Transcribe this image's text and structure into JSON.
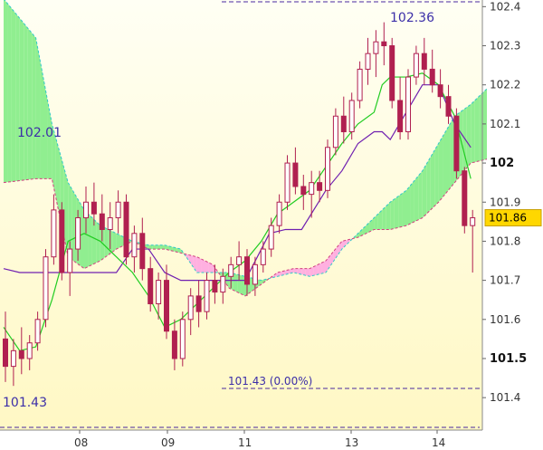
{
  "chart_data": {
    "type": "candlestick",
    "x_labels": [
      "08",
      "09",
      "11",
      "13",
      "14"
    ],
    "y_ticks": [
      {
        "v": 102.4,
        "label": "102.4",
        "bold": false
      },
      {
        "v": 102.3,
        "label": "102.3",
        "bold": false
      },
      {
        "v": 102.2,
        "label": "102.2",
        "bold": false
      },
      {
        "v": 102.1,
        "label": "102.1",
        "bold": false
      },
      {
        "v": 102.0,
        "label": "102",
        "bold": true
      },
      {
        "v": 101.9,
        "label": "101.9",
        "bold": false
      },
      {
        "v": 101.8,
        "label": "101.8",
        "bold": false
      },
      {
        "v": 101.7,
        "label": "101.7",
        "bold": false
      },
      {
        "v": 101.6,
        "label": "101.6",
        "bold": false
      },
      {
        "v": 101.5,
        "label": "101.5",
        "bold": true
      },
      {
        "v": 101.4,
        "label": "101.4",
        "bold": false
      }
    ],
    "ylim": [
      101.317,
      102.417
    ],
    "current_price": "101.86",
    "current_value": 101.86,
    "annotations": {
      "high_label": "102.36",
      "left_label": "102.01",
      "low_label": "101.43",
      "low_line_label": "101.43 (0.00%)"
    },
    "colors": {
      "bull": "#b02050",
      "bear": "#b02050",
      "tenkan": "#7020b0",
      "kijun": "#22cc22",
      "cloud_bull": "#90ee90",
      "cloud_bear": "#ffb0e0",
      "price_tag": "#ffd700"
    },
    "candles": [
      [
        101.55,
        101.62,
        101.44,
        101.48
      ],
      [
        101.48,
        101.55,
        101.43,
        101.52
      ],
      [
        101.52,
        101.58,
        101.46,
        101.5
      ],
      [
        101.5,
        101.56,
        101.47,
        101.54
      ],
      [
        101.54,
        101.62,
        101.52,
        101.6
      ],
      [
        101.6,
        101.78,
        101.58,
        101.76
      ],
      [
        101.76,
        101.92,
        101.74,
        101.88
      ],
      [
        101.88,
        101.9,
        101.7,
        101.72
      ],
      [
        101.72,
        101.8,
        101.66,
        101.78
      ],
      [
        101.78,
        101.88,
        101.75,
        101.86
      ],
      [
        101.86,
        101.94,
        101.82,
        101.9
      ],
      [
        101.9,
        101.95,
        101.84,
        101.87
      ],
      [
        101.87,
        101.92,
        101.8,
        101.83
      ],
      [
        101.83,
        101.9,
        101.78,
        101.86
      ],
      [
        101.86,
        101.93,
        101.82,
        101.9
      ],
      [
        101.9,
        101.92,
        101.74,
        101.76
      ],
      [
        101.76,
        101.84,
        101.72,
        101.82
      ],
      [
        101.82,
        101.86,
        101.7,
        101.73
      ],
      [
        101.73,
        101.76,
        101.62,
        101.64
      ],
      [
        101.64,
        101.72,
        101.6,
        101.7
      ],
      [
        101.7,
        101.74,
        101.55,
        101.57
      ],
      [
        101.57,
        101.6,
        101.47,
        101.5
      ],
      [
        101.5,
        101.62,
        101.48,
        101.6
      ],
      [
        101.6,
        101.68,
        101.56,
        101.66
      ],
      [
        101.66,
        101.7,
        101.58,
        101.62
      ],
      [
        101.62,
        101.72,
        101.6,
        101.7
      ],
      [
        101.7,
        101.74,
        101.64,
        101.67
      ],
      [
        101.67,
        101.73,
        101.64,
        101.71
      ],
      [
        101.71,
        101.76,
        101.68,
        101.74
      ],
      [
        101.74,
        101.8,
        101.7,
        101.76
      ],
      [
        101.76,
        101.78,
        101.66,
        101.69
      ],
      [
        101.69,
        101.76,
        101.66,
        101.74
      ],
      [
        101.74,
        101.8,
        101.72,
        101.78
      ],
      [
        101.78,
        101.86,
        101.76,
        101.84
      ],
      [
        101.84,
        101.92,
        101.82,
        101.9
      ],
      [
        101.9,
        102.02,
        101.88,
        102.0
      ],
      [
        102.0,
        102.04,
        101.92,
        101.94
      ],
      [
        101.94,
        101.97,
        101.88,
        101.92
      ],
      [
        101.92,
        101.98,
        101.86,
        101.95
      ],
      [
        101.95,
        101.98,
        101.9,
        101.93
      ],
      [
        101.93,
        102.06,
        101.91,
        102.04
      ],
      [
        102.04,
        102.14,
        102.02,
        102.12
      ],
      [
        102.12,
        102.17,
        102.05,
        102.08
      ],
      [
        102.08,
        102.18,
        102.06,
        102.16
      ],
      [
        102.16,
        102.26,
        102.14,
        102.24
      ],
      [
        102.24,
        102.32,
        102.2,
        102.28
      ],
      [
        102.28,
        102.34,
        102.22,
        102.31
      ],
      [
        102.31,
        102.36,
        102.25,
        102.3
      ],
      [
        102.3,
        102.32,
        102.14,
        102.16
      ],
      [
        102.16,
        102.22,
        102.06,
        102.08
      ],
      [
        102.08,
        102.24,
        102.06,
        102.22
      ],
      [
        102.22,
        102.3,
        102.2,
        102.28
      ],
      [
        102.28,
        102.32,
        102.2,
        102.24
      ],
      [
        102.24,
        102.29,
        102.18,
        102.2
      ],
      [
        102.2,
        102.24,
        102.14,
        102.17
      ],
      [
        102.17,
        102.2,
        102.1,
        102.12
      ],
      [
        102.12,
        102.14,
        101.96,
        101.98
      ],
      [
        101.98,
        101.99,
        101.82,
        101.84
      ],
      [
        101.84,
        101.88,
        101.72,
        101.86
      ]
    ],
    "tenkan": [
      [
        0,
        101.73
      ],
      [
        2,
        101.72
      ],
      [
        5,
        101.72
      ],
      [
        8,
        101.72
      ],
      [
        10,
        101.72
      ],
      [
        12,
        101.72
      ],
      [
        14,
        101.72
      ],
      [
        16,
        101.78
      ],
      [
        18,
        101.78
      ],
      [
        20,
        101.72
      ],
      [
        22,
        101.7
      ],
      [
        25,
        101.7
      ],
      [
        28,
        101.7
      ],
      [
        30,
        101.7
      ],
      [
        33,
        101.82
      ],
      [
        35,
        101.83
      ],
      [
        37,
        101.83
      ],
      [
        40,
        101.93
      ],
      [
        42,
        101.98
      ],
      [
        44,
        102.05
      ],
      [
        46,
        102.08
      ],
      [
        47,
        102.08
      ],
      [
        48,
        102.06
      ],
      [
        50,
        102.13
      ],
      [
        52,
        102.2
      ],
      [
        54,
        102.2
      ],
      [
        56,
        102.1
      ],
      [
        58,
        102.04
      ]
    ],
    "kijun": [
      [
        0,
        101.58
      ],
      [
        2,
        101.52
      ],
      [
        4,
        101.53
      ],
      [
        6,
        101.65
      ],
      [
        8,
        101.8
      ],
      [
        10,
        101.82
      ],
      [
        12,
        101.8
      ],
      [
        14,
        101.76
      ],
      [
        16,
        101.72
      ],
      [
        18,
        101.66
      ],
      [
        20,
        101.58
      ],
      [
        22,
        101.6
      ],
      [
        24,
        101.64
      ],
      [
        26,
        101.68
      ],
      [
        28,
        101.72
      ],
      [
        30,
        101.75
      ],
      [
        32,
        101.8
      ],
      [
        34,
        101.87
      ],
      [
        36,
        101.9
      ],
      [
        38,
        101.93
      ],
      [
        40,
        101.99
      ],
      [
        42,
        102.05
      ],
      [
        44,
        102.1
      ],
      [
        46,
        102.13
      ],
      [
        47,
        102.2
      ],
      [
        48,
        102.22
      ],
      [
        50,
        102.22
      ],
      [
        52,
        102.23
      ],
      [
        54,
        102.2
      ],
      [
        56,
        102.12
      ],
      [
        58,
        101.96
      ]
    ],
    "cloud_a": [
      [
        0,
        102.42
      ],
      [
        4,
        102.32
      ],
      [
        6,
        102.1
      ],
      [
        8,
        101.95
      ],
      [
        10,
        101.88
      ],
      [
        12,
        101.84
      ],
      [
        14,
        101.82
      ],
      [
        16,
        101.8
      ],
      [
        18,
        101.79
      ],
      [
        20,
        101.79
      ],
      [
        22,
        101.78
      ],
      [
        24,
        101.72
      ],
      [
        26,
        101.72
      ],
      [
        28,
        101.72
      ],
      [
        30,
        101.71
      ],
      [
        32,
        101.7
      ],
      [
        34,
        101.71
      ],
      [
        36,
        101.72
      ],
      [
        38,
        101.71
      ],
      [
        40,
        101.72
      ],
      [
        42,
        101.78
      ],
      [
        44,
        101.82
      ],
      [
        46,
        101.86
      ],
      [
        48,
        101.9
      ],
      [
        50,
        101.93
      ],
      [
        52,
        101.98
      ],
      [
        54,
        102.05
      ],
      [
        56,
        102.12
      ],
      [
        58,
        102.15
      ],
      [
        60,
        102.19
      ]
    ],
    "cloud_b": [
      [
        0,
        101.95
      ],
      [
        4,
        101.96
      ],
      [
        6,
        101.96
      ],
      [
        8,
        101.76
      ],
      [
        10,
        101.73
      ],
      [
        12,
        101.75
      ],
      [
        14,
        101.78
      ],
      [
        16,
        101.8
      ],
      [
        18,
        101.78
      ],
      [
        20,
        101.78
      ],
      [
        22,
        101.77
      ],
      [
        24,
        101.76
      ],
      [
        26,
        101.74
      ],
      [
        28,
        101.68
      ],
      [
        30,
        101.66
      ],
      [
        32,
        101.69
      ],
      [
        34,
        101.72
      ],
      [
        36,
        101.73
      ],
      [
        38,
        101.73
      ],
      [
        40,
        101.75
      ],
      [
        42,
        101.8
      ],
      [
        44,
        101.81
      ],
      [
        46,
        101.83
      ],
      [
        48,
        101.83
      ],
      [
        50,
        101.84
      ],
      [
        52,
        101.86
      ],
      [
        54,
        101.9
      ],
      [
        56,
        101.95
      ],
      [
        58,
        102.0
      ],
      [
        60,
        102.01
      ]
    ]
  }
}
